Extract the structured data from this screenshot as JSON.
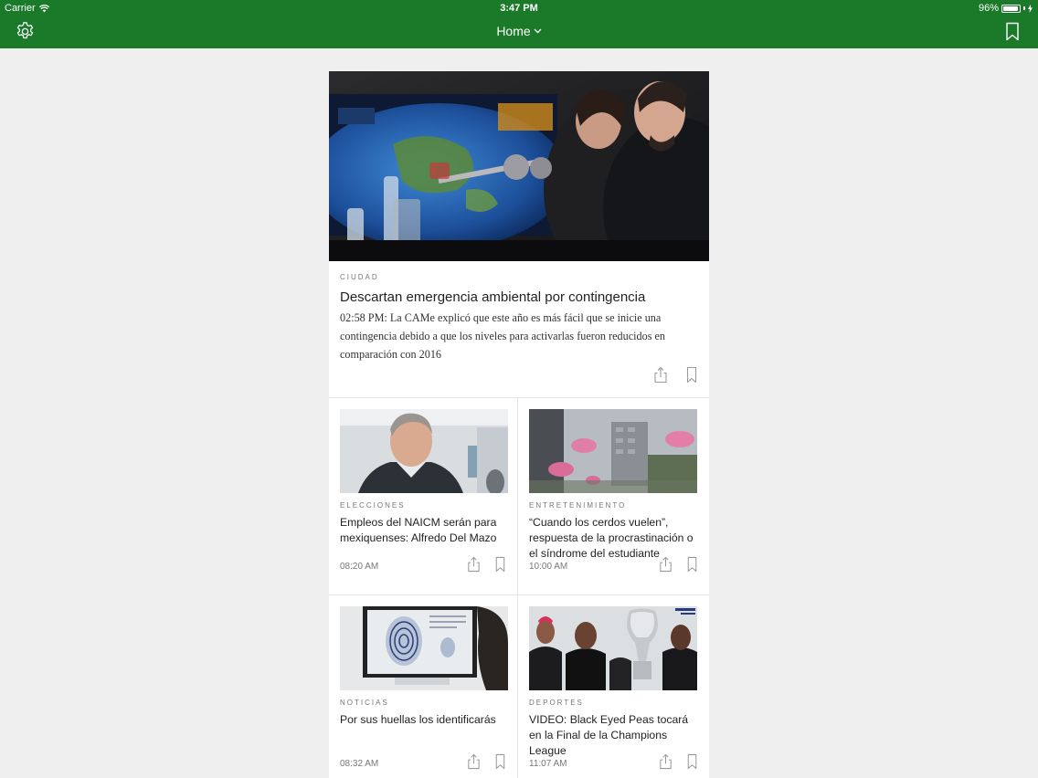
{
  "status_bar": {
    "carrier": "Carrier",
    "time": "3:47 PM",
    "battery": "96%",
    "battery_level": 0.96
  },
  "nav": {
    "title": "Home",
    "left_icon": "gear-icon",
    "title_icon": "chevron-down-icon",
    "right_icon": "bookmark-icon"
  },
  "hero": {
    "category": "CIUDAD",
    "title": "Descartan emergencia ambiental por contingencia",
    "summary": "02:58 PM: La CAMe explicó que este año es más fácil que se inicie una contingencia debido a que los niveles para activarlas fueron reducidos en comparación con 2016",
    "image": "press-conference-photo",
    "actions": [
      "share-icon",
      "bookmark-icon"
    ]
  },
  "articles": [
    {
      "category": "ELECCIONES",
      "title": "Empleos del NAICM serán para mexiquenses: Alfredo Del Mazo",
      "time": "08:20 AM",
      "image": "politician-portrait-photo"
    },
    {
      "category": "ENTRETENIMIENTO",
      "title": "“Cuando los cerdos vuelen”, respuesta de la procrastinación o el síndrome del estudiante",
      "time": "10:00 AM",
      "image": "flying-pigs-photo"
    },
    {
      "category": "NOTICIAS",
      "title": "Por sus huellas los identificarás",
      "time": "08:32 AM",
      "image": "fingerprint-screen-photo"
    },
    {
      "category": "DEPORTES",
      "title": "VIDEO: Black Eyed Peas tocará en la Final de la Champions League",
      "time": "11:07 AM",
      "image": "band-with-trophy-photo"
    }
  ],
  "colors": {
    "nav_bg": "#1b7a2a",
    "page_bg": "#efeff0",
    "card_bg": "#ffffff",
    "kicker": "#777777",
    "icon": "#9a9a9a"
  }
}
